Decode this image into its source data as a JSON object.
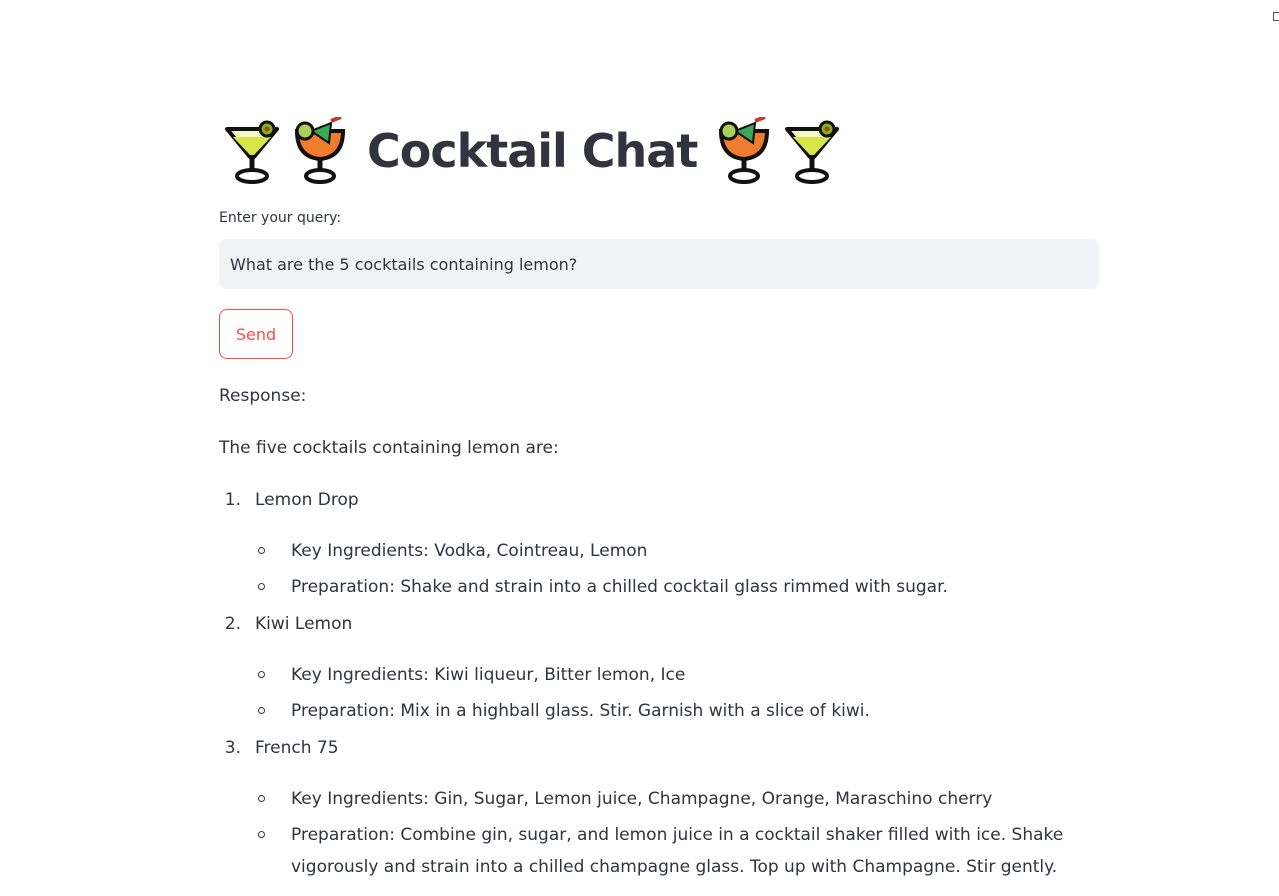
{
  "header": {
    "title": "Cocktail Chat",
    "icons": [
      "cocktail-glass-icon",
      "tropical-drink-icon",
      "tropical-drink-icon",
      "cocktail-glass-icon"
    ]
  },
  "query": {
    "label": "Enter your query:",
    "value": "What are the 5 cocktails containing lemon?"
  },
  "send_button": {
    "label": "Send"
  },
  "response": {
    "label": "Response:",
    "intro": "The five cocktails containing lemon are:",
    "items": [
      {
        "number": "1.",
        "name": "Lemon Drop",
        "ingredients": "Key Ingredients: Vodka, Cointreau, Lemon",
        "preparation": "Preparation: Shake and strain into a chilled cocktail glass rimmed with sugar."
      },
      {
        "number": "2.",
        "name": "Kiwi Lemon",
        "ingredients": "Key Ingredients: Kiwi liqueur, Bitter lemon, Ice",
        "preparation": "Preparation: Mix in a highball glass. Stir. Garnish with a slice of kiwi."
      },
      {
        "number": "3.",
        "name": "French 75",
        "ingredients": "Key Ingredients: Gin, Sugar, Lemon juice, Champagne, Orange, Maraschino cherry",
        "preparation": "Preparation: Combine gin, sugar, and lemon juice in a cocktail shaker filled with ice. Shake vigorously and strain into a chilled champagne glass. Top up with Champagne. Stir gently."
      }
    ]
  },
  "colors": {
    "accent": "#ff4b4b",
    "text": "#31333f",
    "input_bg": "#f0f2f6"
  }
}
